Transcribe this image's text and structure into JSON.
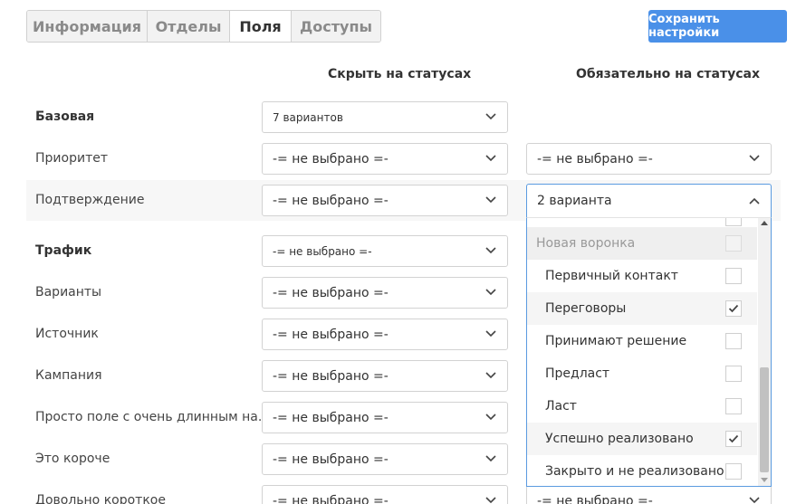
{
  "tabs": [
    {
      "label": "Информация",
      "active": false
    },
    {
      "label": "Отделы",
      "active": false
    },
    {
      "label": "Поля",
      "active": true
    },
    {
      "label": "Доступы",
      "active": false
    }
  ],
  "save_button": "Сохранить настройки",
  "columns": {
    "hide_on_statuses": "Скрыть на статусах",
    "required_on_statuses": "Обязательно на статусах"
  },
  "fields": [
    {
      "label": "Базовая",
      "group": true,
      "hide": "7 вариантов",
      "required": null
    },
    {
      "label": "Приоритет",
      "group": false,
      "hide": "-= не выбрано =-",
      "required": "-= не выбрано =-"
    },
    {
      "label": "Подтверждение",
      "group": false,
      "hide": "-= не выбрано =-",
      "required": "2 варианта"
    },
    {
      "label": "Трафик",
      "group": true,
      "hide": "-= не выбрано =-",
      "required": null
    },
    {
      "label": "Варианты",
      "group": false,
      "hide": "-= не выбрано =-",
      "required": null
    },
    {
      "label": "Источник",
      "group": false,
      "hide": "-= не выбрано =-",
      "required": null
    },
    {
      "label": "Кампания",
      "group": false,
      "hide": "-= не выбрано =-",
      "required": null
    },
    {
      "label": "Просто поле с очень длинным на...",
      "group": false,
      "hide": "-= не выбрано =-",
      "required": null
    },
    {
      "label": "Это короче",
      "group": false,
      "hide": "-= не выбрано =-",
      "required": null
    },
    {
      "label": "Довольно короткое",
      "group": false,
      "hide": "-= не выбрано =-",
      "required": "-= не выбрано =-"
    }
  ],
  "dropdown": {
    "selected_summary": "2 варианта",
    "items": [
      {
        "label": "Новая воронка",
        "group": true,
        "checked": false
      },
      {
        "label": "Первичный контакт",
        "group": false,
        "checked": false
      },
      {
        "label": "Переговоры",
        "group": false,
        "checked": true
      },
      {
        "label": "Принимают решение",
        "group": false,
        "checked": false
      },
      {
        "label": "Предласт",
        "group": false,
        "checked": false
      },
      {
        "label": "Ласт",
        "group": false,
        "checked": false
      },
      {
        "label": "Успешно реализовано",
        "group": false,
        "checked": true
      },
      {
        "label": "Закрыто и не реализовано",
        "group": false,
        "checked": false
      }
    ]
  },
  "colors": {
    "accent": "#4a90e8",
    "focus_border": "#5b9be0",
    "highlight_row": "#f7f7f7"
  },
  "icons": [
    "chevron-down-icon",
    "chevron-up-icon",
    "checkmark-icon"
  ]
}
